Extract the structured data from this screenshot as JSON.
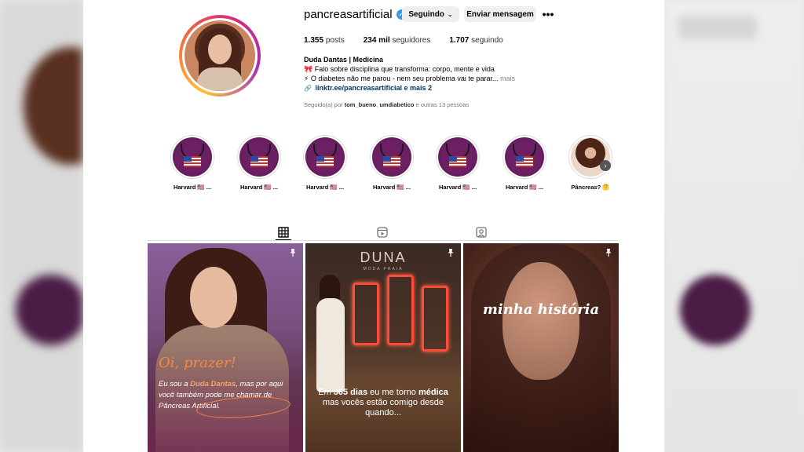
{
  "profile": {
    "username": "pancreasartificial",
    "verified_icon": "verified-badge-icon",
    "follow_button": "Seguindo",
    "message_button": "Enviar mensagem",
    "more_icon": "more-options-icon"
  },
  "stats": {
    "posts_value": "1.355",
    "posts_label": "posts",
    "followers_value": "234 mil",
    "followers_label": "seguidores",
    "following_value": "1.707",
    "following_label": "seguindo"
  },
  "bio": {
    "name": "Duda Dantas | Medicina",
    "line1": "🎀 Falo sobre disciplina que transforma: corpo, mente e vida",
    "line2": "⚡ O diabetes não me parou - nem seu problema vai te parar...",
    "more": "mais",
    "link": "linktr.ee/pancreasartificial e mais 2"
  },
  "followed_by": {
    "prefix": "Seguido(a) por",
    "user1": "tom_bueno",
    "user2": "umdiabetico",
    "suffix": "e outras 13 pessoas"
  },
  "highlights": [
    {
      "label": "Harvard 🇺🇸 ..."
    },
    {
      "label": "Harvard 🇺🇸 ..."
    },
    {
      "label": "Harvard 🇺🇸 ..."
    },
    {
      "label": "Harvard 🇺🇸 ..."
    },
    {
      "label": "Harvard 🇺🇸 ..."
    },
    {
      "label": "Harvard 🇺🇸 ..."
    },
    {
      "label": "Pâncreas? 🤔"
    }
  ],
  "tabs": [
    "grid-icon",
    "reels-icon",
    "tagged-icon"
  ],
  "posts": {
    "post1": {
      "greeting": "Oi, prazer!",
      "text_a": "Eu sou a ",
      "text_name": "Duda Dantas",
      "text_b": ", mas por aqui você também pode me chamar de Pâncreas Artificial."
    },
    "post2": {
      "logo": "DUNA",
      "sub": "MODA PRAIA",
      "text_a": "Em ",
      "text_bold1": "365 dias",
      "text_b": " eu me torno ",
      "text_bold2": "médica",
      "text_c": " mas vocês estão comigo desde quando..."
    },
    "post3": {
      "title": "minha história"
    }
  },
  "colors": {
    "verified": "#3897f0",
    "link": "#00376b",
    "accent_orange": "#f08a45",
    "neon_red": "#ff4b3a"
  }
}
